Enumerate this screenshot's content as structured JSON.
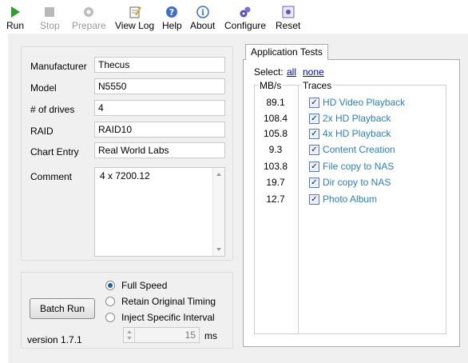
{
  "toolbar": {
    "run": "Run",
    "stop": "Stop",
    "prepare": "Prepare",
    "view_log": "View Log",
    "help": "Help",
    "about": "About",
    "configure": "Configure",
    "reset": "Reset"
  },
  "form": {
    "manufacturer_label": "Manufacturer",
    "manufacturer_value": "Thecus",
    "model_label": "Model",
    "model_value": "N5550",
    "drives_label": "# of drives",
    "drives_value": "4",
    "raid_label": "RAID",
    "raid_value": "RAID10",
    "chart_entry_label": "Chart Entry",
    "chart_entry_value": "Real World Labs",
    "comment_label": "Comment",
    "comment_value": "4 x 7200.12"
  },
  "batch": {
    "button": "Batch Run",
    "version": "version 1.7.1",
    "options": [
      "Full Speed",
      "Retain Original Timing",
      "Inject Specific Interval"
    ],
    "selected_index": 0,
    "interval_value": "15",
    "interval_unit": "ms"
  },
  "tests": {
    "tab_label": "Application Tests",
    "select_label": "Select:",
    "select_all": "all",
    "select_none": "none",
    "col_mbs": "MB/s",
    "col_traces": "Traces",
    "rows": [
      {
        "mbs": "89.1",
        "trace": "HD Video Playback",
        "checked": true
      },
      {
        "mbs": "108.4",
        "trace": "2x HD Playback",
        "checked": true
      },
      {
        "mbs": "105.8",
        "trace": "4x HD Playback",
        "checked": true
      },
      {
        "mbs": "9.3",
        "trace": "Content Creation",
        "checked": true
      },
      {
        "mbs": "103.8",
        "trace": "File copy to NAS",
        "checked": true
      },
      {
        "mbs": "19.7",
        "trace": "Dir copy to NAS",
        "checked": true
      },
      {
        "mbs": "12.7",
        "trace": "Photo Album",
        "checked": true
      }
    ]
  }
}
